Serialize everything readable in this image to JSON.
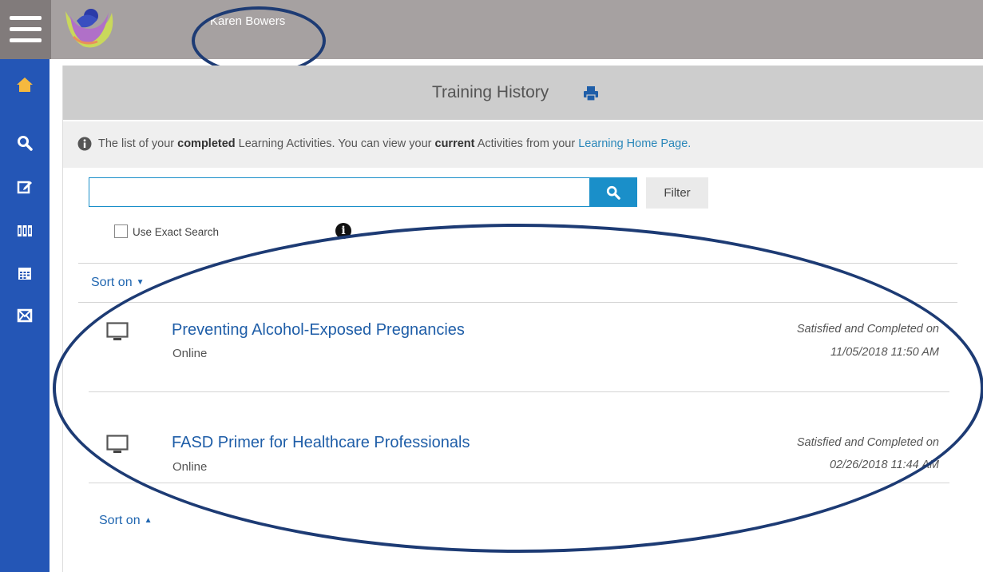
{
  "header": {
    "user_name": "Karen Bowers"
  },
  "sidebar": {
    "items": [
      {
        "icon": "home-icon",
        "active": true
      },
      {
        "icon": "search-icon"
      },
      {
        "icon": "edit-icon"
      },
      {
        "icon": "catalog-icon"
      },
      {
        "icon": "calendar-icon"
      },
      {
        "icon": "mail-icon"
      }
    ]
  },
  "page": {
    "title": "Training History",
    "info": {
      "part1": "The list of your ",
      "bold1": "completed",
      "part2": " Learning Activities. You can view your ",
      "bold2": "current",
      "part3": " Activities from your ",
      "link": "Learning Home Page."
    }
  },
  "search": {
    "value": "",
    "filter_label": "Filter",
    "exact_label": "Use Exact Search",
    "exact_checked": false
  },
  "sort": {
    "label": "Sort on"
  },
  "activities": [
    {
      "title": "Preventing Alcohol-Exposed Pregnancies",
      "type": "Online",
      "status": "Satisfied and Completed on",
      "date": "11/05/2018 11:50 AM"
    },
    {
      "title": "FASD Primer for Healthcare Professionals",
      "type": "Online",
      "status": "Satisfied and Completed on",
      "date": "02/26/2018 11:44 AM"
    }
  ],
  "colors": {
    "sidebar": "#2456b6",
    "topbar": "#a6a1a1",
    "accent": "#1a8fc9",
    "link": "#1f5ea8",
    "annotation": "#1d3b74"
  }
}
